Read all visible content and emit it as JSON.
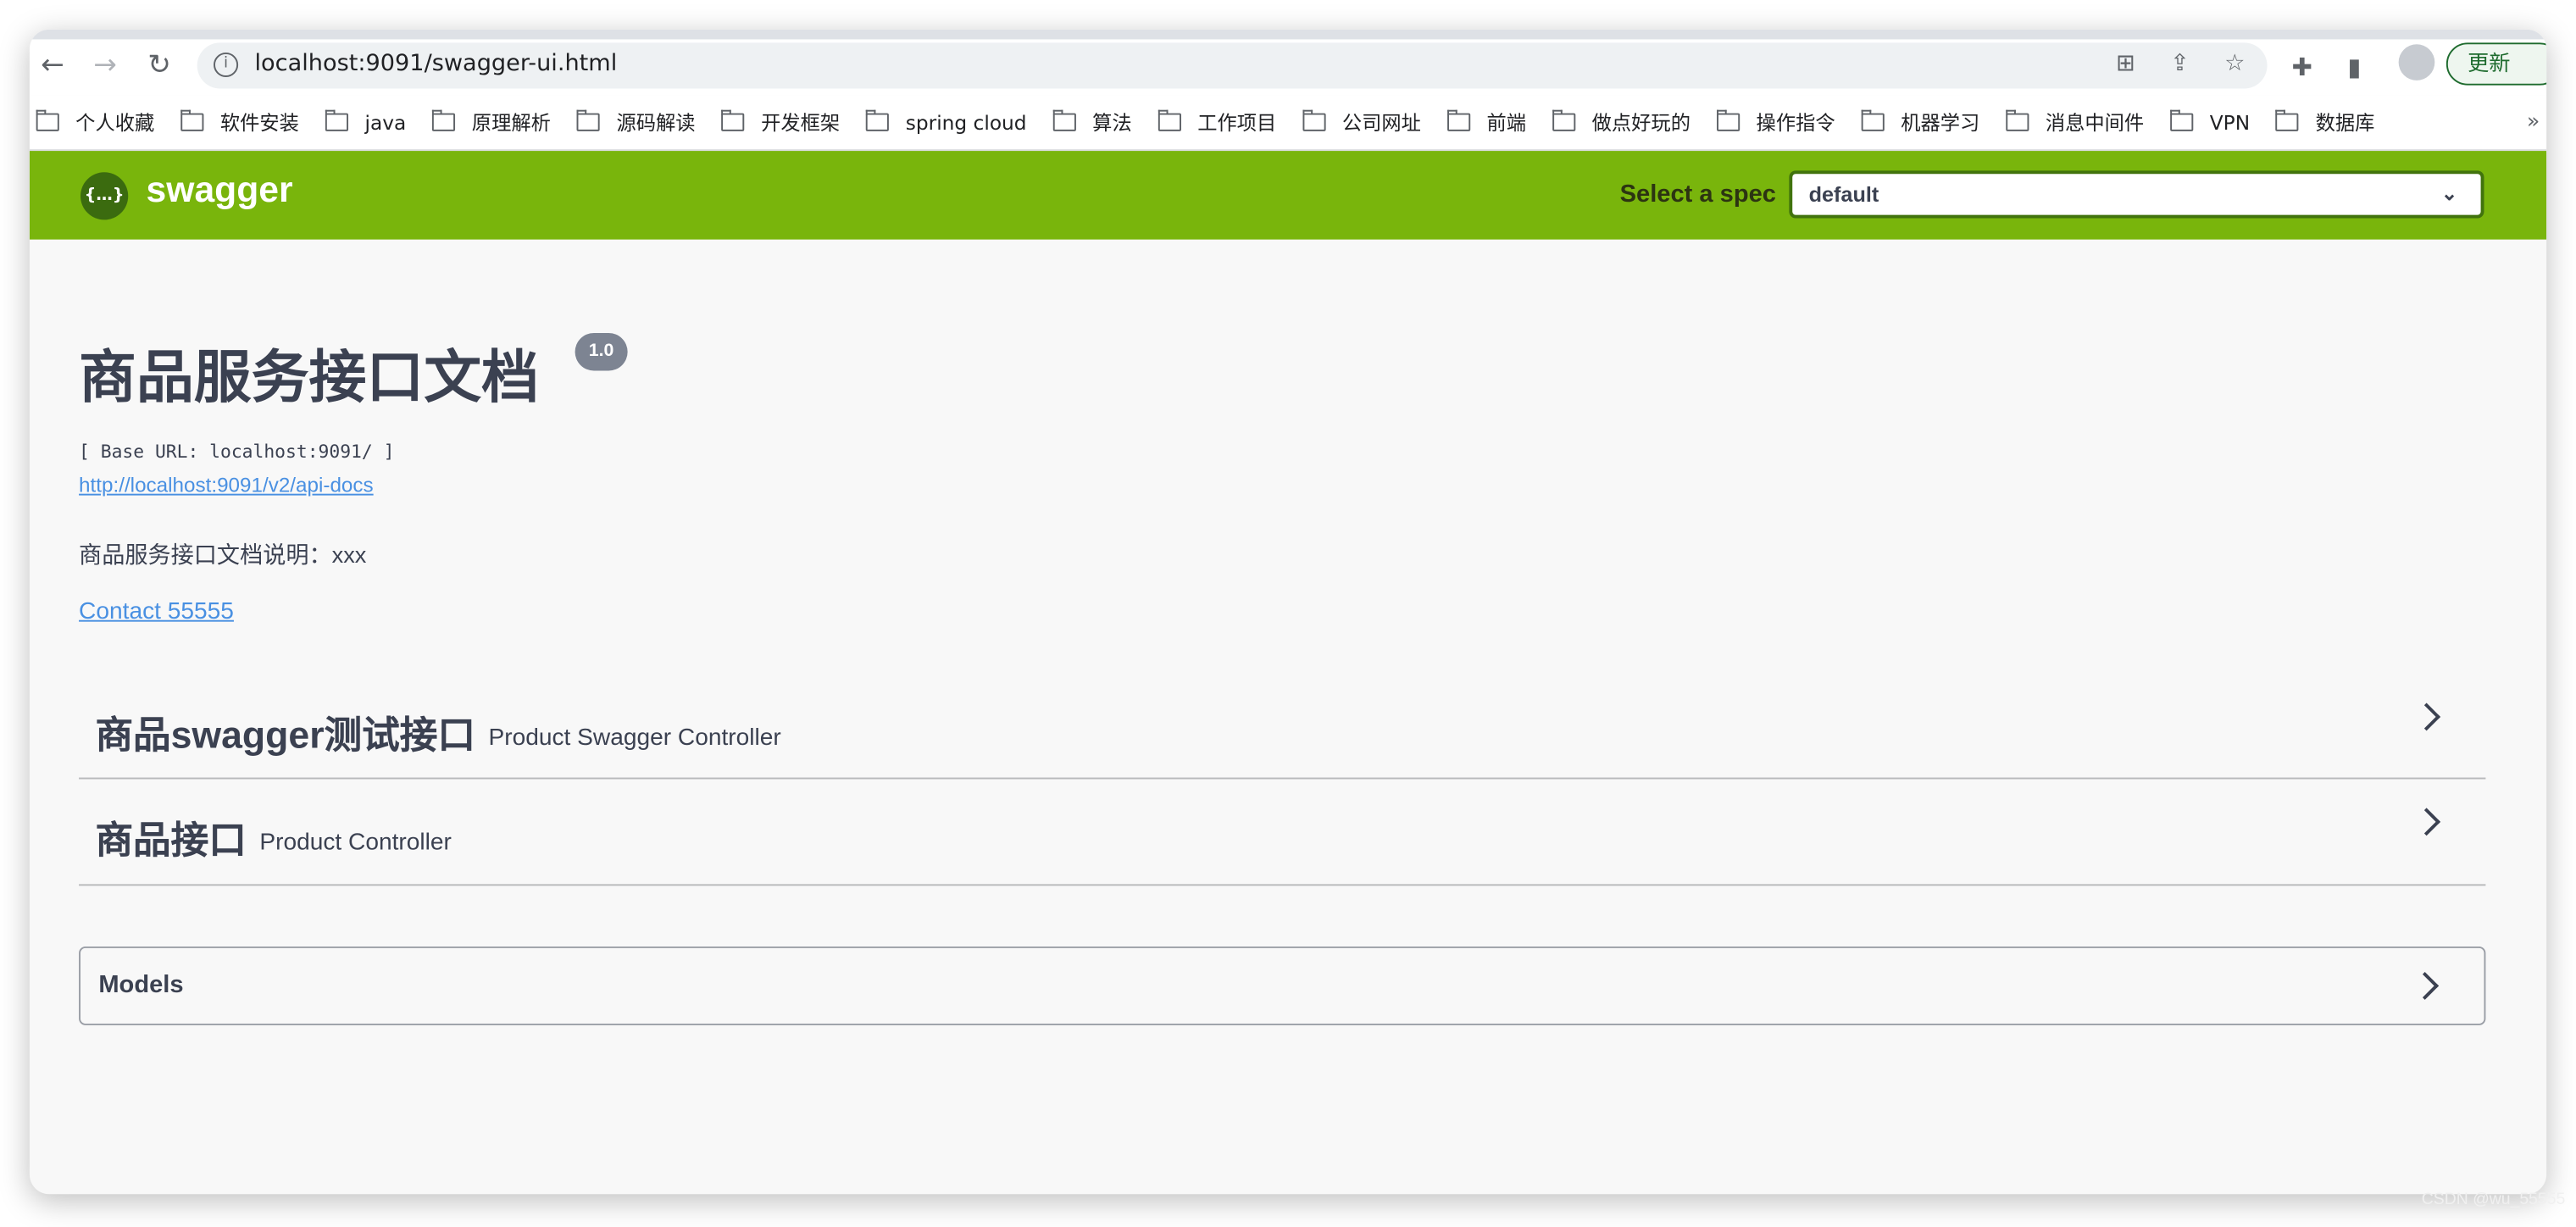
{
  "browser": {
    "url": "localhost:9091/swagger-ui.html",
    "update_label": "更新",
    "bookmarks": [
      "个人收藏",
      "软件安装",
      "java",
      "原理解析",
      "源码解读",
      "开发框架",
      "spring cloud",
      "算法",
      "工作项目",
      "公司网址",
      "前端",
      "做点好玩的",
      "操作指令",
      "机器学习",
      "消息中间件",
      "VPN",
      "数据库"
    ],
    "more_label": "»"
  },
  "header": {
    "logo_glyph": "{…}",
    "brand": "swagger",
    "spec_label": "Select a spec",
    "spec_selected": "default",
    "brand_color": "#79b50c"
  },
  "info": {
    "title": "商品服务接口文档",
    "version": "1.0",
    "base_url": "[ Base URL: localhost:9091/ ]",
    "api_docs_link": "http://localhost:9091/v2/api-docs",
    "description": "商品服务接口文档说明：xxx",
    "contact": "Contact 55555"
  },
  "tags": [
    {
      "name": "商品swagger测试接口",
      "description": "Product Swagger Controller"
    },
    {
      "name": "商品接口",
      "description": "Product Controller"
    }
  ],
  "models": {
    "label": "Models"
  },
  "watermark": "CSDN @wu_55555"
}
